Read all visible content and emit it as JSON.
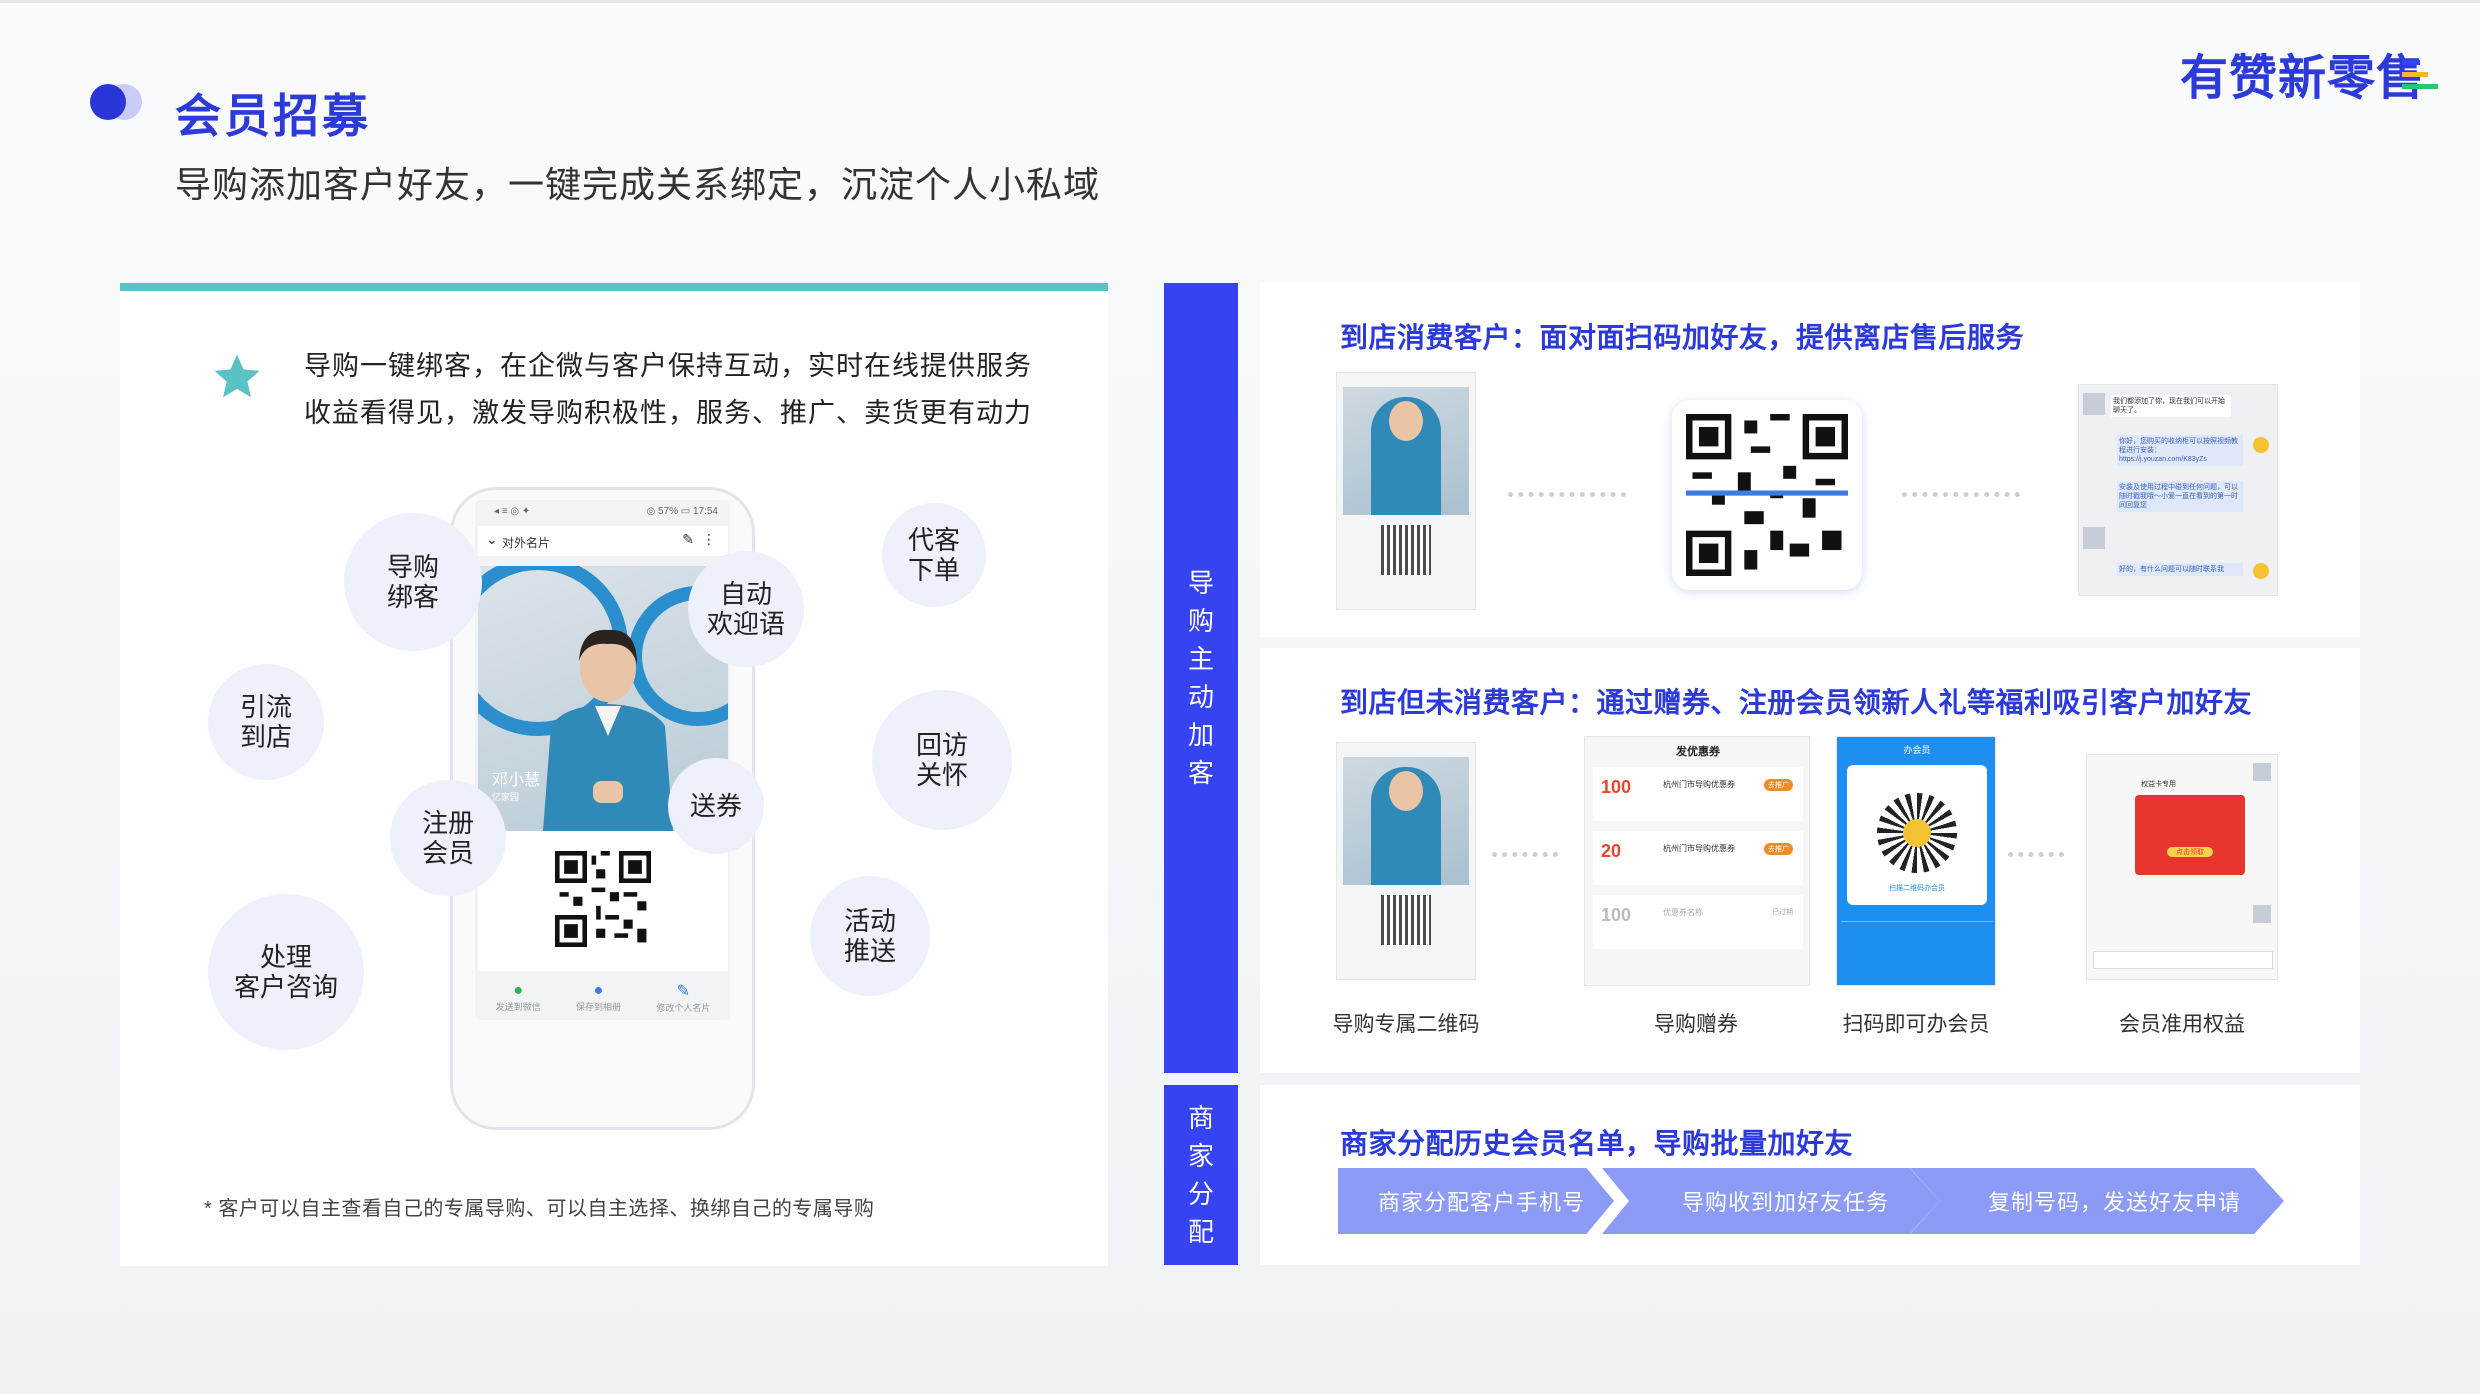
{
  "header": {
    "title": "会员招募",
    "subtitle": "导购添加客户好友，一键完成关系绑定，沉淀个人小私域",
    "logo_text": "有赞新零售"
  },
  "left": {
    "desc_line1": "导购一键绑客，在企微与客户保持互动，实时在线提供服务",
    "desc_line2": "收益看得见，激发导购积极性，服务、推广、卖货更有动力",
    "bubbles": [
      "导购\n绑客",
      "自动\n欢迎语",
      "代客\n下单",
      "引流\n到店",
      "回访\n关怀",
      "注册\n会员",
      "送券",
      "活动\n推送",
      "处理\n客户咨询"
    ],
    "phone": {
      "status_left": "◂ ≡ ◎ ✦",
      "status_right": "◎ 57% ▭ 17:54",
      "header_title": "对外名片",
      "person_name": "邓小慧",
      "person_sub": "亿家园",
      "tabs": [
        "发送到微信",
        "保存到相册",
        "修改个人名片"
      ]
    },
    "footnote": "* 客户可以自主查看自己的专属导购、可以自主选择、换绑自己的专属导购"
  },
  "right": {
    "side_top": [
      "导",
      "购",
      "主",
      "动",
      "加",
      "客"
    ],
    "side_bottom": [
      "商",
      "家",
      "分",
      "配"
    ],
    "section1_title": "到店消费客户：面对面扫码加好友，提供离店售后服务",
    "section2_title": "到店但未消费客户：通过赠券、注册会员领新人礼等福利吸引客户加好友",
    "section2_captions": [
      "导购专属二维码",
      "导购赠券",
      "扫码即可办会员",
      "会员准用权益"
    ],
    "coupon_header": "发优惠券",
    "coupons": [
      {
        "amount": "100",
        "name": "杭州门市导购优惠券",
        "tag": "去推广"
      },
      {
        "amount": "20",
        "name": "杭州门市导购优惠券",
        "tag": "去推广"
      },
      {
        "amount": "100",
        "name": "优惠券名称",
        "tag": "已过期"
      }
    ],
    "member_header": "办会员",
    "member_sub": "扫描二维码办会员",
    "benefit_btn": "点击领取",
    "benefit_title": "权益卡专用",
    "chat_lines": [
      "我们都添加了你，现在我们可以开始聊天了。",
      "你好，您购买的收纳柜可以按照视频教程进行安装：https://j.youzan.com/K83yZs",
      "安装及使用过程中碰到任何问题，可以随时戳我哦～小爱一直在看到的第一时间回复您",
      "好的，有什么问题可以随时联系我"
    ],
    "section3_title": "商家分配历史会员名单，导购批量加好友",
    "flow_steps": [
      "商家分配客户手机号",
      "导购收到加好友任务",
      "复制号码，发送好友申请"
    ]
  },
  "colors": {
    "primary": "#2b3ad8",
    "side_bar": "#3543f2",
    "teal_bar": "#58c3c2",
    "bubble_bg": "#eef0fb",
    "flow_bg": "#8c9cf6"
  }
}
